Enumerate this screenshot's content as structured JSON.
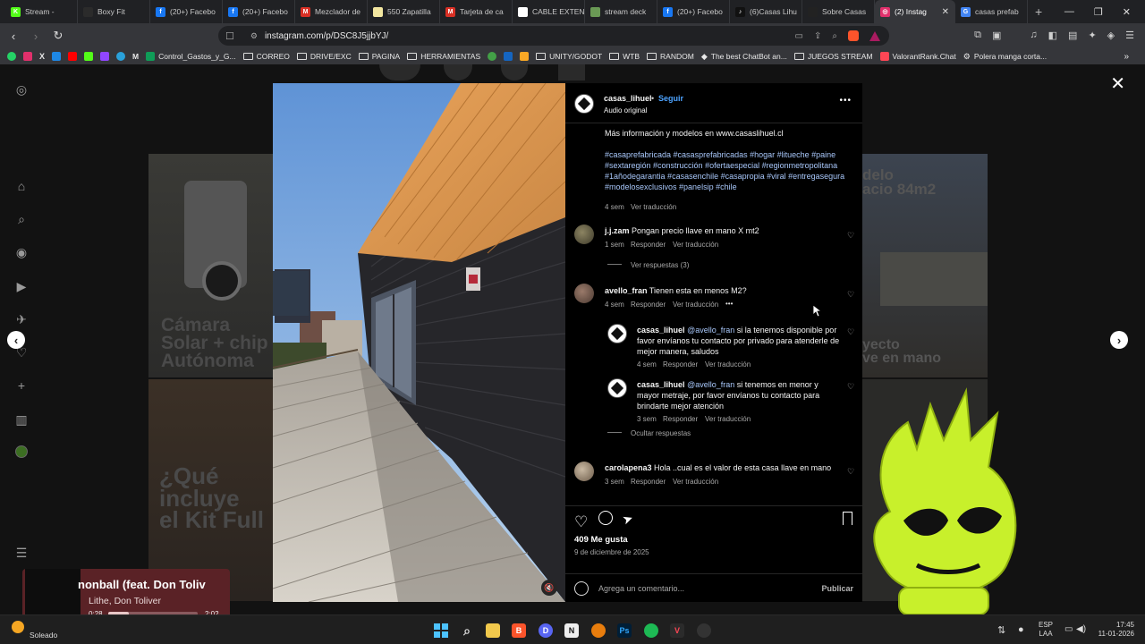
{
  "tabs": [
    {
      "label": "Stream - ",
      "color": "#53fc18",
      "glyph": "K"
    },
    {
      "label": "Boxy Fit",
      "color": "#2b2b2b",
      "glyph": ""
    },
    {
      "label": "(20+) Facebo",
      "color": "#1877f2",
      "glyph": "f"
    },
    {
      "label": "(20+) Facebo",
      "color": "#1877f2",
      "glyph": "f"
    },
    {
      "label": "Mezclador de",
      "color": "#d93025",
      "glyph": "M"
    },
    {
      "label": "550 Zapatilla",
      "color": "#f2e6a0",
      "glyph": ""
    },
    {
      "label": "Tarjeta de ca",
      "color": "#d93025",
      "glyph": "M"
    },
    {
      "label": "CABLE EXTEN",
      "color": "#ffffff",
      "glyph": ""
    },
    {
      "label": "stream deck",
      "color": "#6a9955",
      "glyph": ""
    },
    {
      "label": "(20+) Facebo",
      "color": "#1877f2",
      "glyph": "f"
    },
    {
      "label": "(6)Casas Lihu",
      "color": "#111111",
      "glyph": "♪"
    },
    {
      "label": "Sobre Casas",
      "color": "#222222",
      "glyph": ""
    },
    {
      "label": "(2) Instag",
      "color": "#e1306c",
      "glyph": "◎",
      "active": true
    },
    {
      "label": "casas prefab",
      "color": "#4285f4",
      "glyph": "G"
    }
  ],
  "new_tab": "+",
  "url": "instagram.com/p/DSC8J5jjbYJ/",
  "bookmarks": [
    "Control_Gastos_y_G...",
    "CORREO",
    "DRIVE/EXC",
    "PAGINA",
    "HERRAMIENTAS",
    "UNITY/GODOT",
    "WTB",
    "RANDOM",
    "The best ChatBot an...",
    "JUEGOS STREAM",
    "ValorantRank.Chat",
    "Polera manga corta..."
  ],
  "post": {
    "username": "casas_lihuel",
    "follow": "Seguir",
    "audio": "Audio original",
    "caption": "Más información y modelos en www.casaslihuel.cl",
    "hashtags": "#casaprefabricada #casasprefabricadas #hogar #litueche #paine #sextaregión #construcción #ofertaespecial #regionmetropolitana #1añodegarantia #casasenchile #casapropia #viral #entregasegura #modelosexclusivos #panelsip #chile",
    "caption_time": "4 sem",
    "see_translation": "Ver traducción",
    "likes": "409 Me gusta",
    "date": "9 de diciembre de 2025",
    "comment_placeholder": "Agrega un comentario...",
    "publish": "Publicar"
  },
  "comments": {
    "c1": {
      "user": "j.j.zam",
      "text": "Pongan precio llave en mano X mt2",
      "time": "1 sem",
      "reply": "Responder",
      "translate": "Ver traducción",
      "replies": "Ver respuestas (3)"
    },
    "c2": {
      "user": "avello_fran",
      "text": "Tienen esta en menos M2?",
      "time": "4 sem",
      "reply": "Responder",
      "translate": "Ver traducción",
      "more": "•••"
    },
    "r1": {
      "user": "casas_lihuel",
      "mention": "@avello_fran",
      "text": "si la tenemos disponible por favor envíanos tu contacto por privado para atenderle de mejor manera, saludos",
      "time": "4 sem",
      "reply": "Responder",
      "translate": "Ver traducción"
    },
    "r2": {
      "user": "casas_lihuel",
      "mention": "@avello_fran",
      "text": "si tenemos en menor y mayor metraje, por favor envíanos tu contacto para brindarte mejor atención",
      "time": "3 sem",
      "reply": "Responder",
      "translate": "Ver traducción"
    },
    "hide": "Ocultar respuestas",
    "c3": {
      "user": "carolapena3",
      "text": "Hola ..cual es el valor de esta casa llave en mano",
      "time": "3 sem",
      "reply": "Responder",
      "translate": "Ver traducción"
    }
  },
  "background_cards": {
    "left_top": "Cámara\nSolar + chip\nAutónoma",
    "left_bottom": "¿Qué\nincluye\nel Kit Full",
    "right_top": "delo\nacio 84m2",
    "right_mid": "yecto\nve en mano"
  },
  "music": {
    "title": "nonball (feat. Don Toliv",
    "artist": "Lithe, Don Toliver",
    "elapsed": "0:28",
    "duration": "2:02",
    "progress": 0.23
  },
  "weather": {
    "status": "Soleado"
  },
  "tray": {
    "lang1": "ESP",
    "lang2": "LAA",
    "time": "17:45",
    "date": "11-01-2026"
  }
}
